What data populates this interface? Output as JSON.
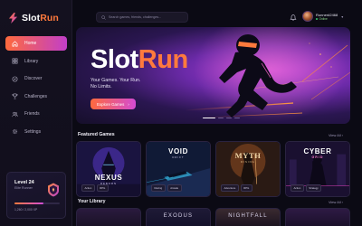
{
  "app": {
    "name_part1": "Slot",
    "name_part2": "Run"
  },
  "sidebar": {
    "items": [
      {
        "label": "Home",
        "icon": "home-icon",
        "active": true
      },
      {
        "label": "Library",
        "icon": "grid-icon",
        "active": false
      },
      {
        "label": "Discover",
        "icon": "compass-icon",
        "active": false
      },
      {
        "label": "Challenges",
        "icon": "trophy-icon",
        "active": false
      },
      {
        "label": "Friends",
        "icon": "users-icon",
        "active": false
      },
      {
        "label": "Settings",
        "icon": "gear-icon",
        "active": false
      }
    ],
    "level_card": {
      "title": "Level 24",
      "subtitle": "Elite Runner",
      "xp_text": "1,260 / 2,000 XP",
      "xp_progress": 0.63
    }
  },
  "header": {
    "search_placeholder": "Search games, friends, challenges...",
    "user": {
      "name": "Runner#2468",
      "status": "Online"
    }
  },
  "hero": {
    "title_part1": "Slot",
    "title_part2": "Run",
    "subtitle_line1": "Your Games. Your Run.",
    "subtitle_line2": "No Limits.",
    "cta_label": "Explore Games",
    "cta_arrow": "›"
  },
  "featured": {
    "title": "Featured Games",
    "view_all": "View All ›",
    "games": [
      {
        "title": "NEXUS",
        "subtitle": "REBORN",
        "tags": [
          "Action",
          "RPG"
        ]
      },
      {
        "title": "VOID",
        "subtitle": "DRIFT",
        "tags": [
          "Racing",
          "Arcade"
        ]
      },
      {
        "title": "MYTH",
        "subtitle": "RISING",
        "tags": [
          "Adventure",
          "RPG"
        ]
      },
      {
        "title": "CYBER",
        "subtitle": "GRID",
        "tags": [
          "Action",
          "Strategy"
        ]
      }
    ]
  },
  "library": {
    "title": "Your Library",
    "view_all": "View All ›",
    "games": [
      {
        "title": ""
      },
      {
        "title": "EXODUS"
      },
      {
        "title": "NIGHTFALL"
      },
      {
        "title": ""
      }
    ]
  },
  "colors": {
    "accent_orange": "#ff7a3d",
    "accent_magenta": "#c23fc9",
    "bg": "#0b0a14"
  }
}
